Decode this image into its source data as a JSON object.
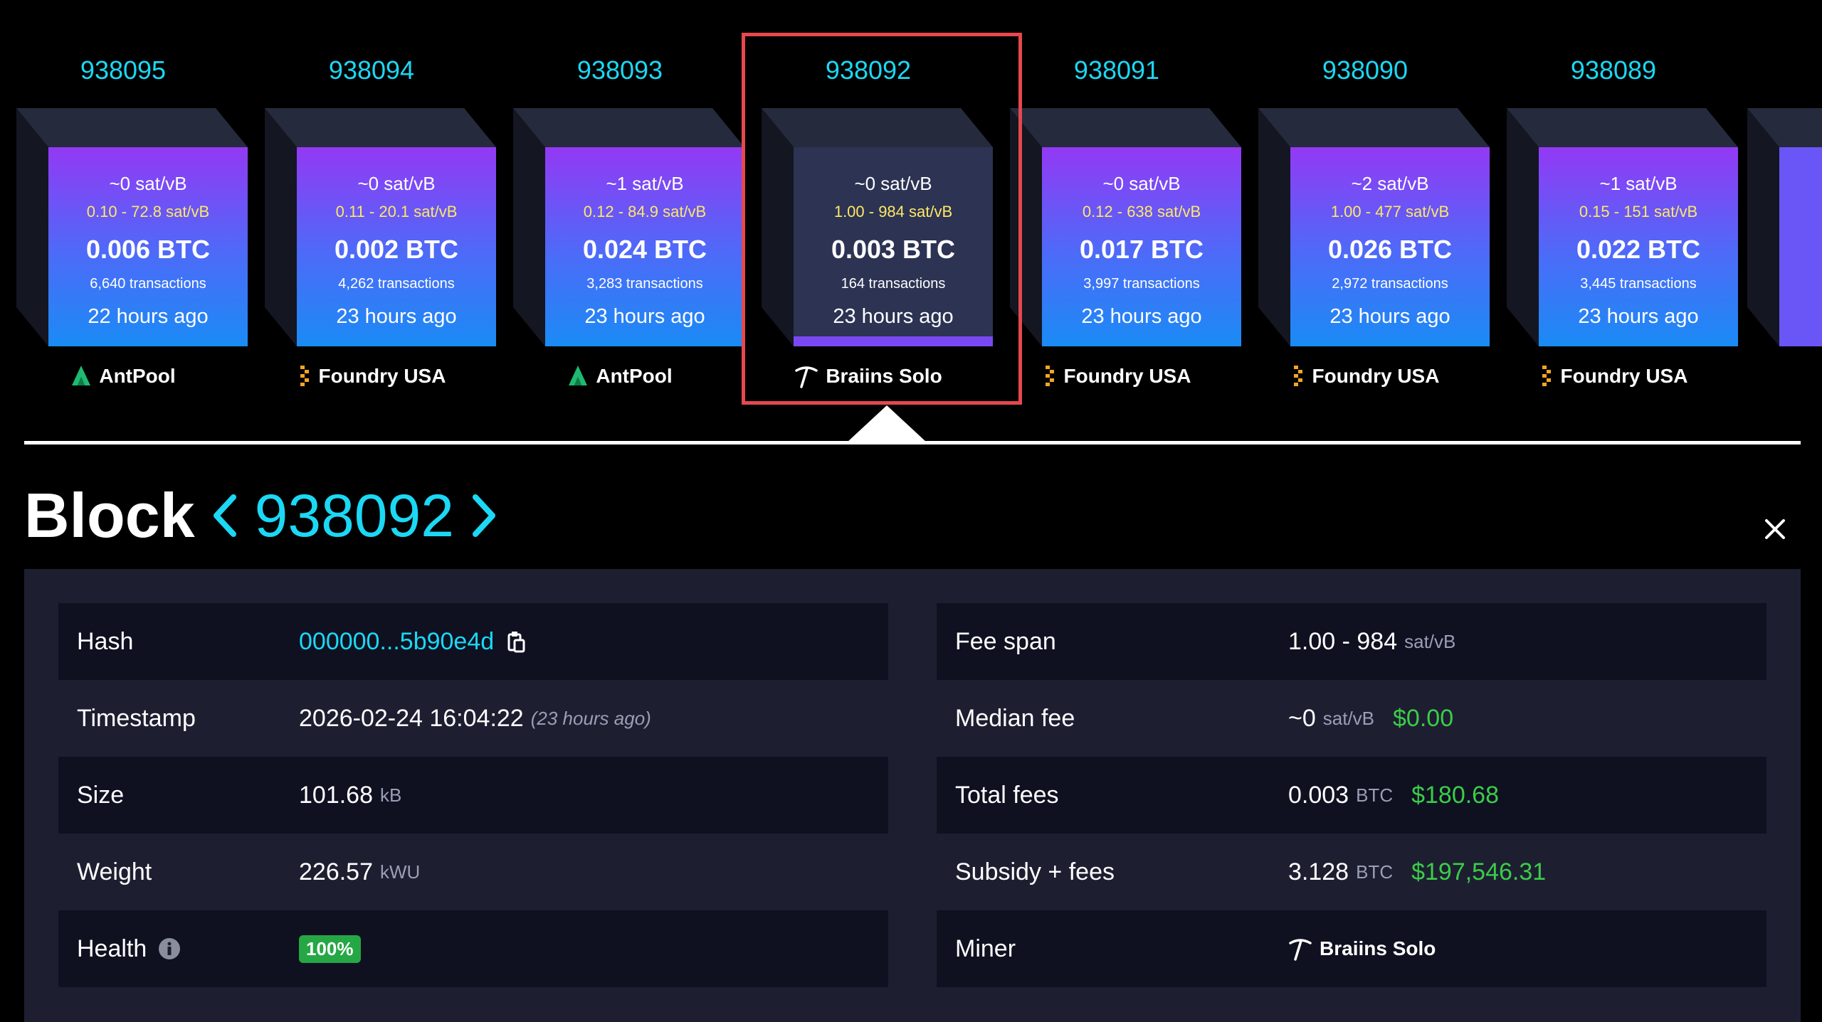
{
  "blocks": [
    {
      "height": "938095",
      "median_fee": "~0 sat/vB",
      "fee_range": "0.10 - 72.8 sat/vB",
      "total": "0.006 BTC",
      "tx_count": "6,640 transactions",
      "time": "22 hours ago",
      "miner": "AntPool",
      "miner_icon": "antpool-icon"
    },
    {
      "height": "938094",
      "median_fee": "~0 sat/vB",
      "fee_range": "0.11 - 20.1 sat/vB",
      "total": "0.002 BTC",
      "tx_count": "4,262 transactions",
      "time": "23 hours ago",
      "miner": "Foundry USA",
      "miner_icon": "foundry-icon"
    },
    {
      "height": "938093",
      "median_fee": "~1 sat/vB",
      "fee_range": "0.12 - 84.9 sat/vB",
      "total": "0.024 BTC",
      "tx_count": "3,283 transactions",
      "time": "23 hours ago",
      "miner": "AntPool",
      "miner_icon": "antpool-icon"
    },
    {
      "height": "938092",
      "median_fee": "~0 sat/vB",
      "fee_range": "1.00 - 984 sat/vB",
      "total": "0.003 BTC",
      "tx_count": "164 transactions",
      "time": "23 hours ago",
      "miner": "Braiins Solo",
      "miner_icon": "pickaxe-icon",
      "selected": true
    },
    {
      "height": "938091",
      "median_fee": "~0 sat/vB",
      "fee_range": "0.12 - 638 sat/vB",
      "total": "0.017 BTC",
      "tx_count": "3,997 transactions",
      "time": "23 hours ago",
      "miner": "Foundry USA",
      "miner_icon": "foundry-icon"
    },
    {
      "height": "938090",
      "median_fee": "~2 sat/vB",
      "fee_range": "1.00 - 477 sat/vB",
      "total": "0.026 BTC",
      "tx_count": "2,972 transactions",
      "time": "23 hours ago",
      "miner": "Foundry USA",
      "miner_icon": "foundry-icon"
    },
    {
      "height": "938089",
      "median_fee": "~1 sat/vB",
      "fee_range": "0.15 - 151 sat/vB",
      "total": "0.022 BTC",
      "tx_count": "3,445 transactions",
      "time": "23 hours ago",
      "miner": "Foundry USA",
      "miner_icon": "foundry-icon"
    }
  ],
  "header": {
    "title_word": "Block",
    "height": "938092"
  },
  "details": {
    "left": {
      "hash_label": "Hash",
      "hash_value": "000000...5b90e4d",
      "timestamp_label": "Timestamp",
      "timestamp_value": "2026-02-24 16:04:22",
      "timestamp_relative": "(23 hours ago)",
      "size_label": "Size",
      "size_value": "101.68",
      "size_unit": "kB",
      "weight_label": "Weight",
      "weight_value": "226.57",
      "weight_unit": "kWU",
      "health_label": "Health",
      "health_value": "100%"
    },
    "right": {
      "fee_span_label": "Fee span",
      "fee_span_value": "1.00 - 984",
      "fee_span_unit": "sat/vB",
      "median_fee_label": "Median fee",
      "median_fee_value": "~0",
      "median_fee_unit": "sat/vB",
      "median_fee_usd": "$0.00",
      "total_fees_label": "Total fees",
      "total_fees_value": "0.003",
      "total_fees_unit": "BTC",
      "total_fees_usd": "$180.68",
      "subsidy_label": "Subsidy + fees",
      "subsidy_value": "3.128",
      "subsidy_unit": "BTC",
      "subsidy_usd": "$197,546.31",
      "miner_label": "Miner",
      "miner_value": "Braiins Solo"
    }
  },
  "colors": {
    "accent": "#1bd8f4",
    "usd": "#3bcc49",
    "range": "#ffe866",
    "selection": "#e5484d",
    "health": "#26a745"
  }
}
